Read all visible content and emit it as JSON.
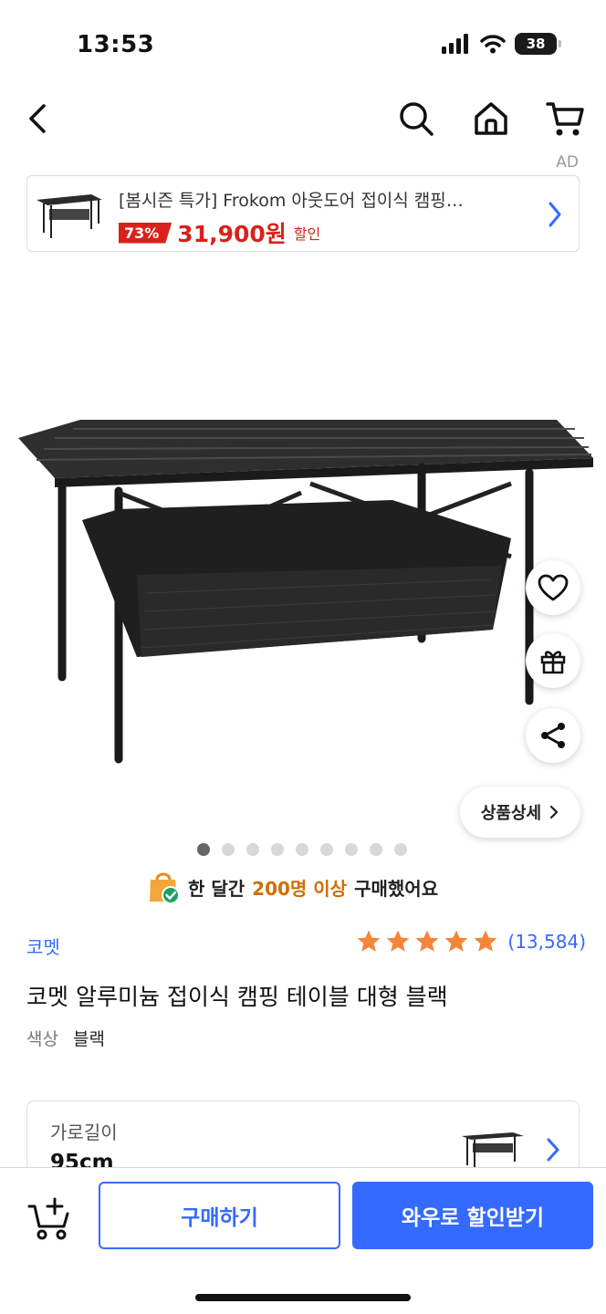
{
  "status_bar": {
    "time": "13:53",
    "battery": "38",
    "battery_level": 0.38
  },
  "nav": {
    "back_icon": "chevron-left-icon",
    "icons": [
      "search-icon",
      "home-icon",
      "cart-icon"
    ]
  },
  "ad": {
    "label": "AD",
    "title": "[봄시즌 특가] Frokom 아웃도어 접이식 캠핑…",
    "discount": "73%",
    "price": "31,900원",
    "sale_text": "할인"
  },
  "floating_actions": [
    "heart-icon",
    "gift-icon",
    "share-icon"
  ],
  "detail_button": {
    "label": "상품상세"
  },
  "gallery": {
    "total": 9,
    "active": 0
  },
  "purchase_notice": {
    "prefix": "한 달간",
    "highlight": "200명 이상",
    "suffix": "구매했어요"
  },
  "product": {
    "brand": "코멧",
    "rating": 5,
    "review_count": "(13,584)",
    "title": "코멧 알루미늄 접이식 캠핑 테이블 대형 블랙",
    "option_label": "색상",
    "option_value": "블랙"
  },
  "option_box": {
    "name": "가로길이",
    "value": "95cm"
  },
  "bottom_bar": {
    "buy_label": "구매하기",
    "wow_label": "와우로 할인받기"
  },
  "colors": {
    "accent": "#346aff",
    "sale_red": "#d9211b",
    "star_orange": "#f6853a",
    "highlight_orange": "#d06e00"
  }
}
